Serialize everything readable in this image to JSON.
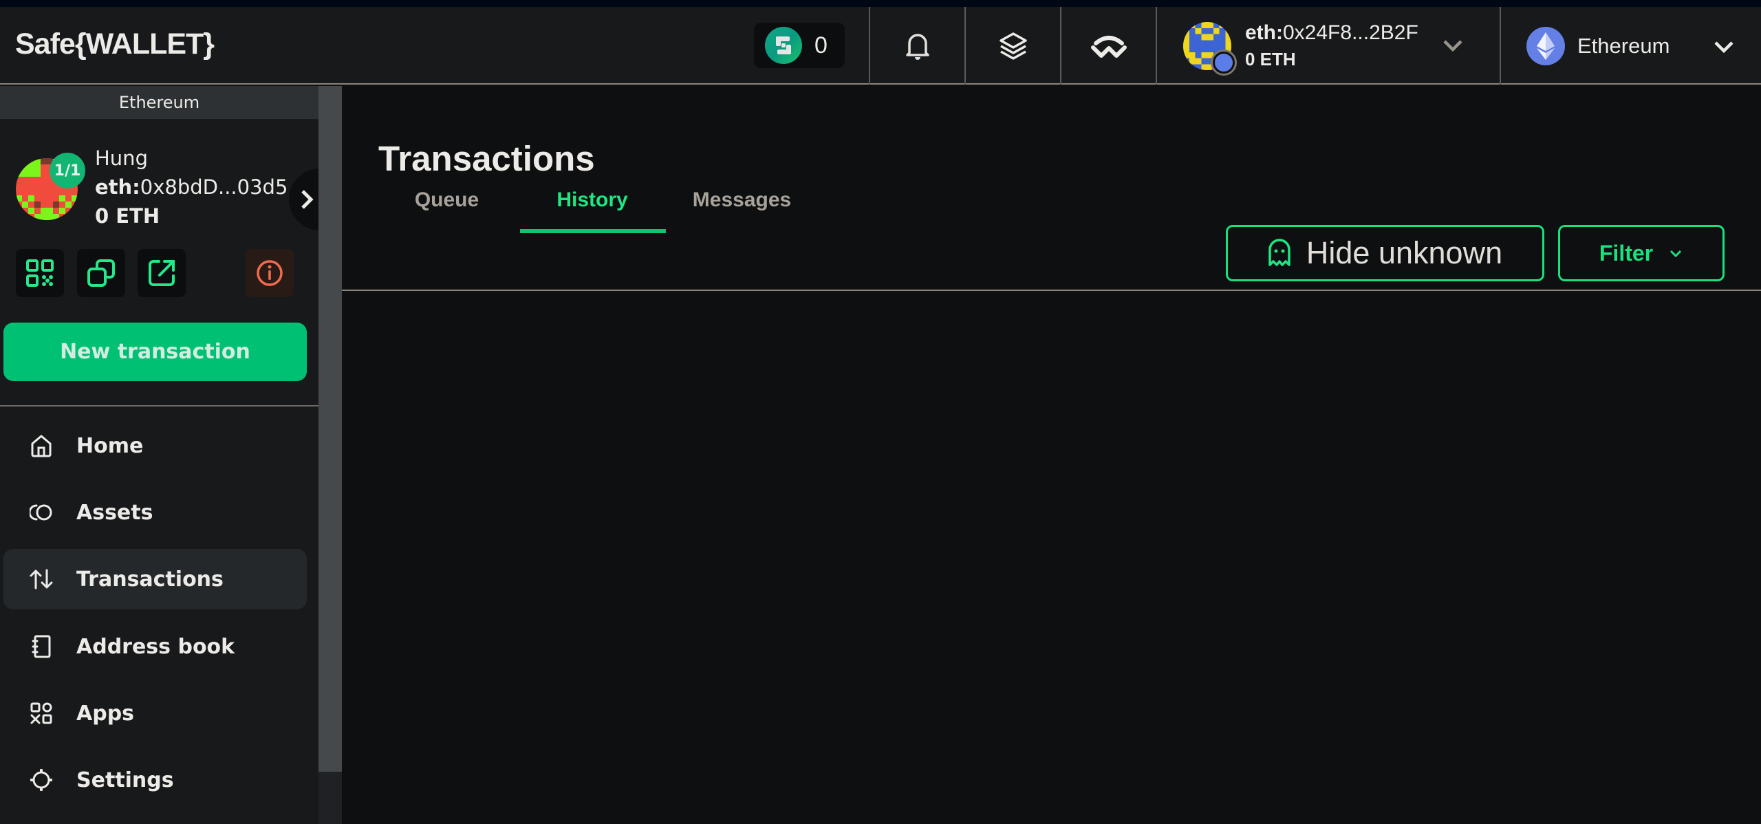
{
  "app": {
    "logo": "Safe{WALLET}"
  },
  "header": {
    "points": {
      "count": "0",
      "icon": "safe-points-icon"
    },
    "icons": [
      "bell-icon",
      "layers-icon",
      "walletconnect-icon"
    ],
    "account": {
      "prefix": "eth:",
      "address": "0x24F8...2B2F",
      "balance": "0 ETH"
    },
    "network": {
      "name": "Ethereum"
    }
  },
  "sidebar": {
    "network_banner": "Ethereum",
    "safe": {
      "threshold": "1/1",
      "name": "Hung",
      "prefix": "eth:",
      "address": "0x8bdD...03d5",
      "balance": "0 ETH"
    },
    "actions": [
      "qr-code-icon",
      "copy-icon",
      "external-link-icon",
      "info-icon"
    ],
    "new_transaction_label": "New transaction",
    "nav": [
      {
        "label": "Home",
        "icon": "home-icon",
        "active": false
      },
      {
        "label": "Assets",
        "icon": "assets-icon",
        "active": false
      },
      {
        "label": "Transactions",
        "icon": "transactions-icon",
        "active": true
      },
      {
        "label": "Address book",
        "icon": "address-book-icon",
        "active": false
      },
      {
        "label": "Apps",
        "icon": "apps-icon",
        "active": false
      },
      {
        "label": "Settings",
        "icon": "settings-icon",
        "active": false
      }
    ]
  },
  "main": {
    "title": "Transactions",
    "tabs": [
      {
        "label": "Queue",
        "active": false
      },
      {
        "label": "History",
        "active": true
      },
      {
        "label": "Messages",
        "active": false
      }
    ],
    "hide_unknown_label": "Hide unknown",
    "filter_label": "Filter"
  },
  "colors": {
    "accent": "#12c171",
    "accent_bright": "#1fe683",
    "warning": "#f26b4f",
    "background": "#0e0f11",
    "panel": "#18191b"
  }
}
